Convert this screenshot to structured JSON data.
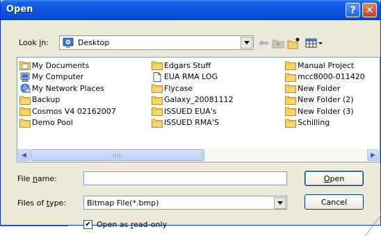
{
  "window": {
    "title": "Open",
    "help_label": "?",
    "close_label": "✕"
  },
  "lookin": {
    "label_prefix": "Look ",
    "label_accel": "i",
    "label_suffix": "n:",
    "value": "Desktop"
  },
  "files": {
    "col1": [
      {
        "name": "My Documents",
        "icon": "documents-icon"
      },
      {
        "name": "My Computer",
        "icon": "computer-icon"
      },
      {
        "name": "My Network Places",
        "icon": "network-icon"
      },
      {
        "name": "Backup",
        "icon": "folder-icon"
      },
      {
        "name": "Cosmos V4 02162007",
        "icon": "folder-icon"
      },
      {
        "name": "Demo Pool",
        "icon": "folder-icon"
      }
    ],
    "col2": [
      {
        "name": "Edgars Stuff",
        "icon": "folder-icon"
      },
      {
        "name": "EUA RMA LOG",
        "icon": "file-icon"
      },
      {
        "name": "Flycase",
        "icon": "folder-icon"
      },
      {
        "name": "Galaxy_20081112",
        "icon": "folder-icon"
      },
      {
        "name": "ISSUED EUA's",
        "icon": "folder-icon"
      },
      {
        "name": "ISSUED RMA'S",
        "icon": "folder-icon"
      }
    ],
    "col3": [
      {
        "name": "Manual Project",
        "icon": "folder-icon"
      },
      {
        "name": "mcc8000-011420",
        "icon": "folder-icon"
      },
      {
        "name": "New Folder",
        "icon": "folder-icon"
      },
      {
        "name": "New Folder (2)",
        "icon": "folder-icon"
      },
      {
        "name": "New Folder (3)",
        "icon": "folder-icon"
      },
      {
        "name": "Schilling",
        "icon": "folder-icon"
      }
    ]
  },
  "filename": {
    "label_prefix": "File ",
    "label_accel": "n",
    "label_suffix": "ame:",
    "value": ""
  },
  "filetype": {
    "label_prefix": "Files of ",
    "label_accel": "t",
    "label_suffix": "ype:",
    "value": "Bitmap File(*.bmp)"
  },
  "buttons": {
    "open_accel": "O",
    "open_rest": "pen",
    "cancel": "Cancel"
  },
  "readonly": {
    "checked": true,
    "label_prefix": "Open as ",
    "label_accel": "r",
    "label_suffix": "ead-only"
  }
}
